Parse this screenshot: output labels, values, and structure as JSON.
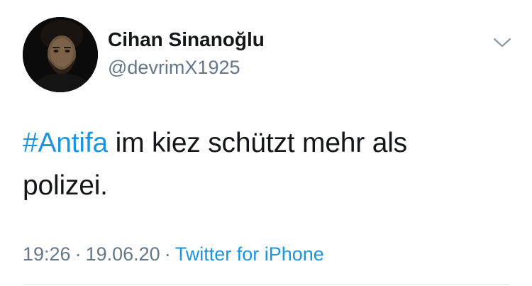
{
  "author": {
    "display_name": "Cihan Sinanoğlu",
    "handle": "@devrimX1925"
  },
  "tweet": {
    "hashtag": "#Antifa",
    "text": " im kiez schützt mehr als polizei."
  },
  "meta": {
    "time": "19:26",
    "separator": "·",
    "date": "19.06.20",
    "source": "Twitter for iPhone"
  },
  "icons": {
    "menu": "chevron-down-icon"
  },
  "colors": {
    "link": "#1b95e0",
    "secondary_text": "#657786",
    "primary_text": "#14171a"
  }
}
